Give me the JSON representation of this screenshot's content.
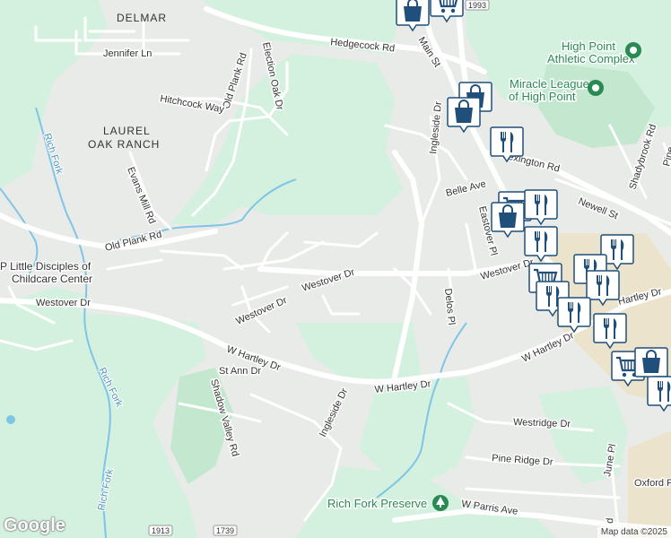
{
  "map": {
    "areas": {
      "delmar": "DELMAR",
      "laurel1": "LAUREL",
      "laurel2": "OAK RANCH"
    },
    "pois": {
      "athletic1": "High Point",
      "athletic2": "Athletic Complex",
      "miracle1": "Miracle League",
      "miracle2": "of High Point",
      "preserve": "Rich Fork Preserve",
      "childcare1": "P Little Disciples of",
      "childcare2": "Childcare Center"
    },
    "roads": {
      "hedgecock": "Hedgecock Rd",
      "main_st": "Main St",
      "jennifer": "Jennifer Ln",
      "election_oak": "Election Oak Dr",
      "old_plank_1": "Old Plank Rd",
      "old_plank_2": "Old Plank Rd",
      "hitchcock": "Hitchcock Way",
      "evans_mill": "Evans Mill Rd",
      "westover_dr_1": "Westover Dr",
      "westover_dr_2": "Westover Dr",
      "westover_dr_3": "Westover Dr",
      "westover_dr_4": "Westover Dr",
      "w_hartley_1": "W Hartley Dr",
      "w_hartley_2": "W Hartley Dr",
      "w_hartley_3": "W Hartley Dr",
      "hartley_dr": "Hartley Dr",
      "st_ann": "St Ann Dr",
      "shadow_valley": "Shadow Valley Rd",
      "ingleside_1": "Ingleside Dr",
      "ingleside_2": "Ingleside Dr",
      "delos": "Delos Pl",
      "belle": "Belle Ave",
      "eastover": "Eastover Pl",
      "lexington": "Lexington Rd",
      "newell": "Newell St",
      "shadybrook": "Shadybrook Rd",
      "pine_oak": "Pine",
      "westridge": "Westridge Dr",
      "pine_ridge": "Pine Ridge Dr",
      "june": "June Pl",
      "oxford": "Oxford Pl",
      "w_parris": "W Parris Ave",
      "fd": "d"
    },
    "water": {
      "rich_fork_1": "Rich Fork",
      "rich_fork_2": "Rich Fork",
      "rich_fork_3": "Rich Fork"
    },
    "shields": {
      "s1993": "1993",
      "s1913": "1913",
      "s1739": "1739"
    },
    "icons": [
      "shopping-bag-icon",
      "shopping-cart-icon",
      "shopping-bag-icon",
      "shopping-bag-icon",
      "restaurant-icon",
      "shopping-cart-icon",
      "restaurant-icon",
      "shopping-bag-icon",
      "restaurant-icon",
      "restaurant-icon",
      "shopping-cart-icon",
      "restaurant-icon",
      "restaurant-icon",
      "restaurant-icon",
      "restaurant-icon",
      "restaurant-icon",
      "shopping-cart-icon",
      "shopping-bag-icon",
      "restaurant-icon"
    ],
    "colors": {
      "land": "#e9ebe8",
      "park": "#d4f0de",
      "park_dark": "#c3e8cf",
      "commercial": "#ece3cc",
      "water": "#7ec5e6",
      "road": "#ffffff",
      "marker": "#1f4f7a",
      "poi_green": "#2a8a53"
    }
  },
  "footer": {
    "logo": "Google",
    "copyright": "Map data ©2025"
  }
}
